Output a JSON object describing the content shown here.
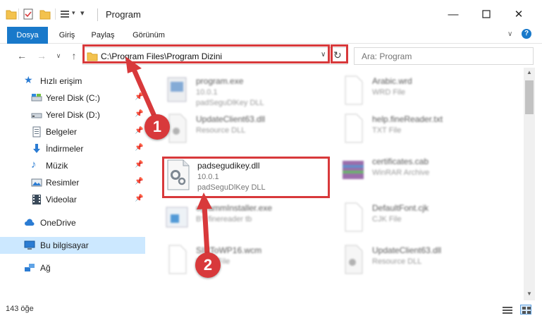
{
  "window": {
    "title": "Program"
  },
  "ribbon": {
    "tabs": [
      "Dosya",
      "Giriş",
      "Paylaş",
      "Görünüm"
    ]
  },
  "address": {
    "path": "C:\\Program Files\\Program Dizini"
  },
  "search": {
    "placeholder": "Ara: Program"
  },
  "sidebar": {
    "quick_access": "Hızlı erişim",
    "items": [
      {
        "label": "Yerel Disk (C:)",
        "pinned": true
      },
      {
        "label": "Yerel Disk (D:)",
        "pinned": true
      },
      {
        "label": "Belgeler",
        "pinned": true
      },
      {
        "label": "İndirmeler",
        "pinned": true
      },
      {
        "label": "Müzik",
        "pinned": true
      },
      {
        "label": "Resimler",
        "pinned": true
      },
      {
        "label": "Videolar",
        "pinned": true
      }
    ],
    "onedrive": "OneDrive",
    "this_pc": "Bu bilgisayar",
    "network": "Ağ"
  },
  "files": [
    {
      "name": "program.exe",
      "line2": "10.0.1",
      "line3": "padSeguDlKey DLL"
    },
    {
      "name": "Arabic.wrd",
      "line2": "WRD File",
      "line3": ""
    },
    {
      "name": "UpdateClient63.dll",
      "line2": "Resource DLL",
      "line3": ""
    },
    {
      "name": "help.fineReader.txt",
      "line2": "TXT File",
      "line3": ""
    },
    {
      "name": "padsegudikey.dll",
      "line2": "10.0.1",
      "line3": "padSeguDlKey DLL"
    },
    {
      "name": "certificates.cab",
      "line2": "WinRAR Archive",
      "line3": ""
    },
    {
      "name": "ogrammInstaller.exe",
      "line2": "BY finereader tb",
      "line3": ""
    },
    {
      "name": "DefaultFont.cjk",
      "line2": "CJK File",
      "line3": ""
    },
    {
      "name": "SIRToWP16.wcm",
      "line2": "WCM File",
      "line3": ""
    },
    {
      "name": "UpdateClient63.dll",
      "line2": "Resource DLL",
      "line3": ""
    }
  ],
  "status": {
    "item_count": "143 öğe"
  },
  "markers": [
    "1",
    "2"
  ],
  "colors": {
    "accent": "#1979ca",
    "highlight": "#d8393b",
    "selection": "#cce8ff"
  }
}
